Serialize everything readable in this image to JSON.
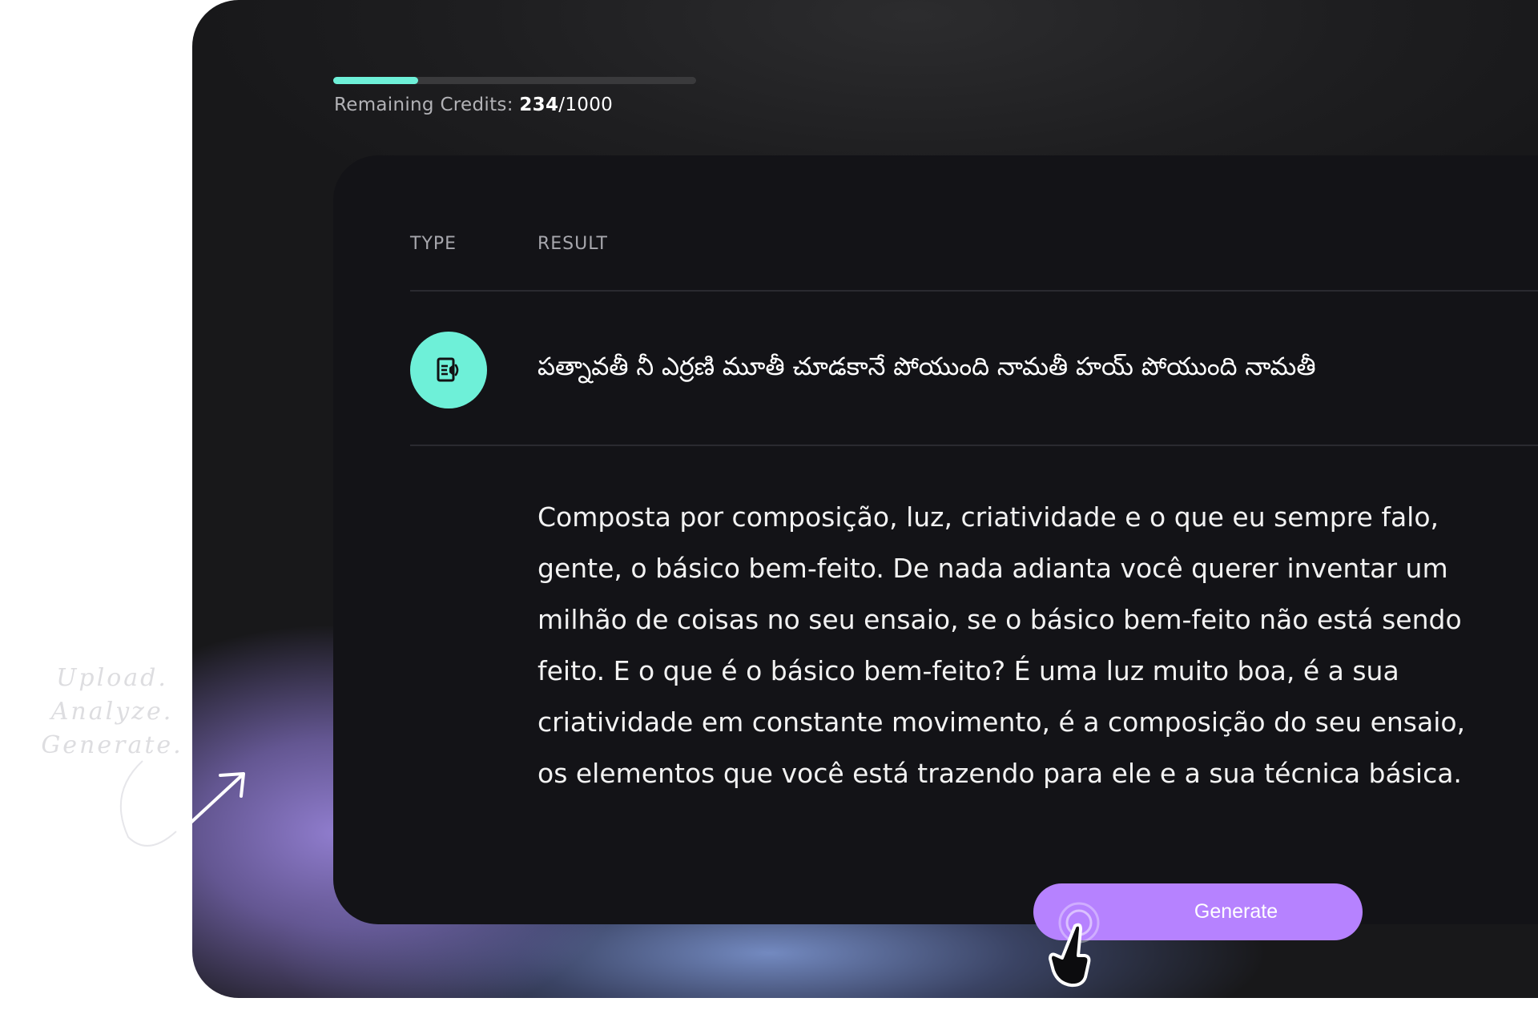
{
  "credits": {
    "label": "Remaining Credits: ",
    "used": "234",
    "separator": "/",
    "total": "1000",
    "progress_fraction": 0.234,
    "progress_color": "#6ef0d8"
  },
  "table": {
    "headers": {
      "type": "TYPE",
      "result": "RESULT"
    },
    "row": {
      "type_icon": "audio-transcript-icon",
      "result_title": "పత్నావతీ నీ ఎర్రణి మూతీ చూడకానే పోయుంది నామతీ హయ్ పోయుంది నామతీ",
      "result_body": "Composta por composição, luz, criatividade e o que eu sempre falo, gente, o básico bem-feito. De nada adianta você querer inventar um milhão de coisas no seu ensaio, se o básico bem-feito não está sendo feito. E o que é o básico bem-feito? É uma luz muito boa, é a sua criatividade em constante movimento, é a composição do seu ensaio, os elementos que você está trazendo para ele e a sua técnica básica."
    }
  },
  "actions": {
    "generate_label": "Generate",
    "generate_color": "#b682ff",
    "cursor_icon": "hand-pointer-icon"
  },
  "tagline": {
    "line1": "Upload. Analyze.",
    "line2": "Generate."
  },
  "colors": {
    "frame_background": "#1e1e20",
    "card_background": "#131317",
    "accent_mint": "#6ef0d8",
    "accent_purple": "#b682ff"
  }
}
